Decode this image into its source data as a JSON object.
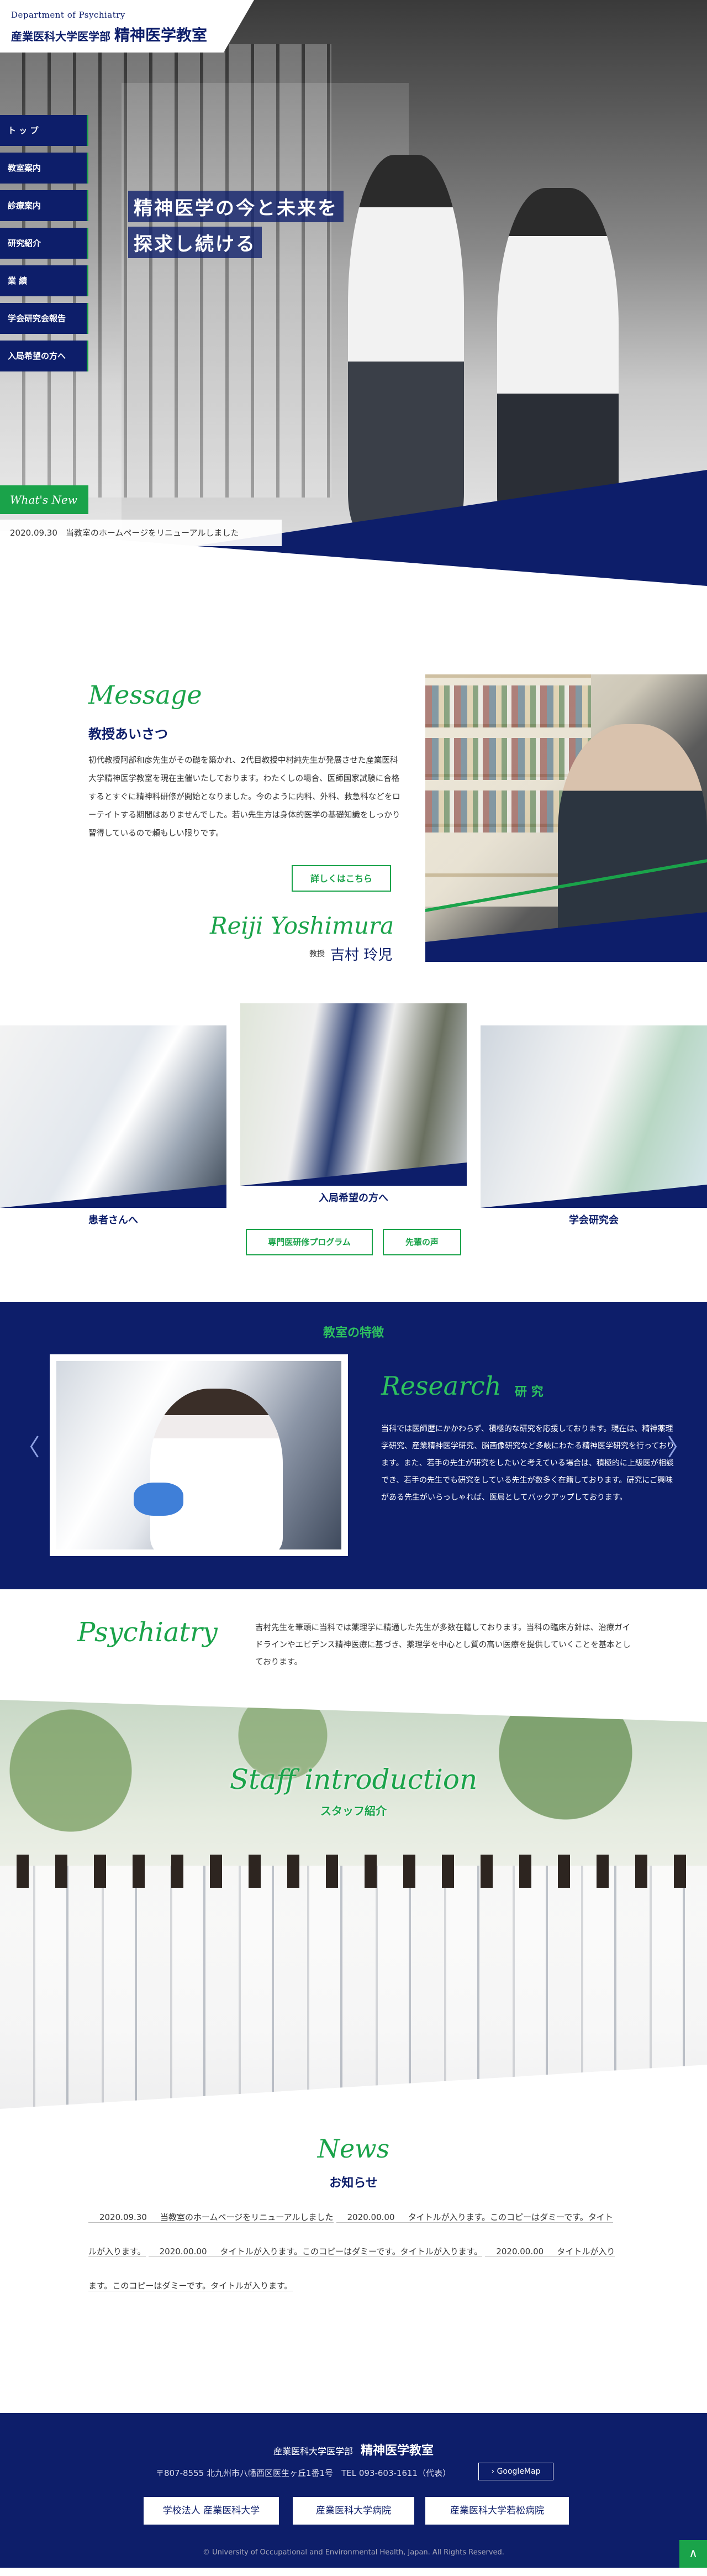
{
  "header": {
    "dept_en": "Department of Psychiatry",
    "univ": "産業医科大学医学部",
    "name": "精神医学教室"
  },
  "nav": [
    "ト ッ プ",
    "教室案内",
    "診療案内",
    "研究紹介",
    "業 績",
    "学会研究会報告",
    "入局希望の方へ"
  ],
  "hero": {
    "catch_line1": "精神医学の今と未来を",
    "catch_line2": "探求し続ける"
  },
  "whats_new": {
    "title": "What's New",
    "item": "2020.09.30　当教室のホームページをリニューアルしました"
  },
  "message": {
    "title_en": "Message",
    "title_ja": "教授あいさつ",
    "body": "初代教授阿部和彦先生がその礎を築かれ、2代目教授中村純先生が発展させた産業医科大学精神医学教室を現在主催いたしております。わたくしの場合、医師国家試験に合格するとすぐに精神科研修が開始となりました。今のように内科、外科、救急科などをローテイトする期間はありませんでした。若い先生方は身体的医学の基礎知識をしっかり習得しているので頼もしい限りです。",
    "more": "詳しくはこちら",
    "sig_en": "Reiji Yoshimura",
    "sig_role": "教授",
    "sig_name": "吉村 玲児"
  },
  "cards": {
    "patient": "患者さんへ",
    "recruit": "入局希望の方へ",
    "society": "学会研究会",
    "btn_program": "専門医研修プログラム",
    "btn_voice": "先輩の声"
  },
  "features": {
    "sub": "教室の特徴",
    "title_en": "Research",
    "title_ja": "研 究",
    "body": "当科では医師歴にかかわらず、積極的な研究を応援しております。現在は、精神薬理学研究、産業精神医学研究、脳画像研究など多岐にわたる精神医学研究を行っております。また、若手の先生が研究をしたいと考えている場合は、積極的に上級医が相談でき、若手の先生でも研究をしている先生が数多く在籍しております。研究にご興味がある先生がいらっしゃれば、医局としてバックアップしております。",
    "arrow_left": "〈",
    "arrow_right": "〉"
  },
  "psychiatry": {
    "title_en": "Psychiatry",
    "body": "吉村先生を筆頭に当科では薬理学に精通した先生が多数在籍しております。当科の臨床方針は、治療ガイドラインやエビデンス精神医療に基づき、薬理学を中心とし質の高い医療を提供していくことを基本としております。"
  },
  "staff": {
    "title_en": "Staff introduction",
    "title_ja": "スタッフ紹介"
  },
  "news": {
    "title_en": "News",
    "title_ja": "お知らせ",
    "items": [
      {
        "date": "2020.09.30",
        "text": "当教室のホームページをリニューアルしました"
      },
      {
        "date": "2020.00.00",
        "text": "タイトルが入ります。このコピーはダミーです。タイトルが入ります。"
      },
      {
        "date": "2020.00.00",
        "text": "タイトルが入ります。このコピーはダミーです。タイトルが入ります。"
      },
      {
        "date": "2020.00.00",
        "text": "タイトルが入ります。このコピーはダミーです。タイトルが入ります。"
      }
    ]
  },
  "footer": {
    "univ": "産業医科大学医学部",
    "name": "精神医学教室",
    "address": "〒807-8555 北九州市八幡西区医生ヶ丘1番1号　TEL 093-603-1611（代表）",
    "map_btn": "› GoogleMap",
    "banner1": "学校法人 産業医科大学",
    "banner2": "産業医科大学病院",
    "banner3": "産業医科大学若松病院",
    "copyright": "© University of Occupational and Environmental Health, Japan. All Rights Reserved.",
    "pagetop": "∧"
  },
  "colors": {
    "navy": "#0d1e6a",
    "green": "#1aa34a"
  }
}
